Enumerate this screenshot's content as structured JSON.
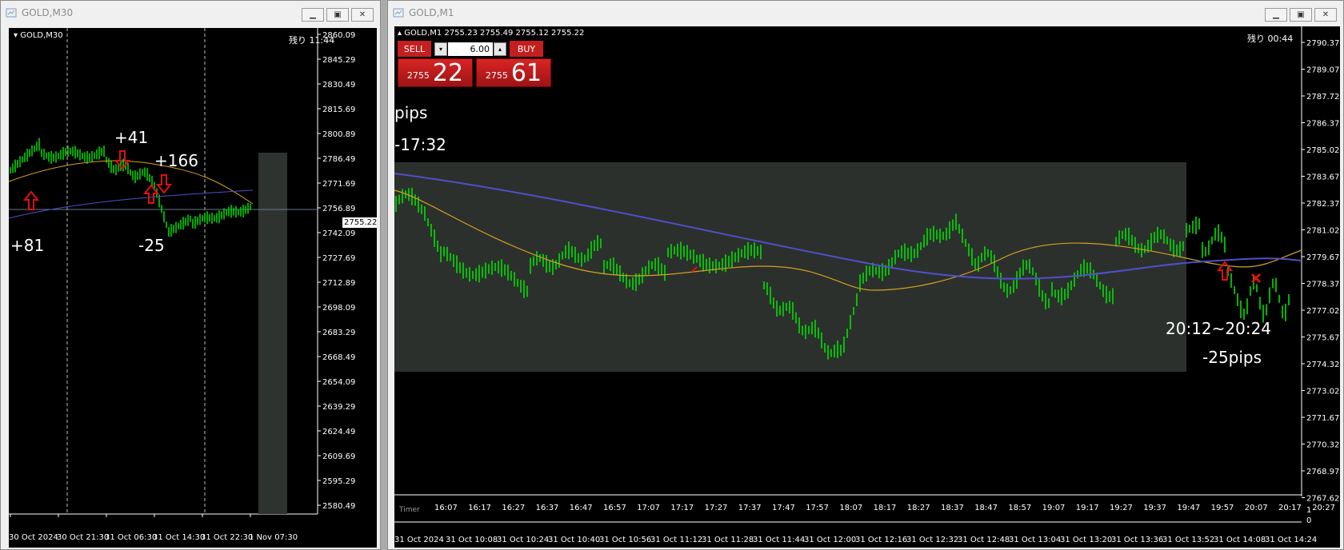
{
  "left_window": {
    "title": "GOLD,M30",
    "chart_label": "GOLD,M30",
    "countdown": "残り 11:44",
    "price_tag": "2755.22",
    "y_ticks": [
      "2860.09",
      "2845.29",
      "2830.49",
      "2815.69",
      "2800.89",
      "2786.49",
      "2771.69",
      "2756.89",
      "2742.09",
      "2727.69",
      "2712.89",
      "2698.09",
      "2683.29",
      "2668.49",
      "2654.09",
      "2639.29",
      "2624.49",
      "2609.69",
      "2595.29",
      "2580.49"
    ],
    "x_ticks": [
      "30 Oct 2024",
      "30 Oct 21:30",
      "31 Oct 06:30",
      "31 Oct 14:30",
      "31 Oct 22:30",
      "1 Nov 07:30"
    ],
    "annotations": {
      "a1": "+41",
      "a2": "+166",
      "a3": "+81",
      "a4": "-25"
    }
  },
  "right_window": {
    "title": "GOLD,M1",
    "chart_label": "GOLD,M1  2755.23 2755.49 2755.12 2755.22",
    "countdown": "残り 00:44",
    "one_click": {
      "sell_label": "SELL",
      "buy_label": "BUY",
      "lot": "6.00",
      "sell_small": "2755",
      "sell_big": "22",
      "buy_small": "2755",
      "buy_big": "61"
    },
    "annotations": {
      "pips": "pips",
      "time_left": "-17:32",
      "range": "20:12~20:24",
      "result": "-25pips"
    },
    "y_ticks": [
      "2790.37",
      "2789.07",
      "2787.72",
      "2786.37",
      "2785.02",
      "2783.67",
      "2782.37",
      "2781.02",
      "2779.67",
      "2778.37",
      "2777.02",
      "2775.67",
      "2774.32",
      "2773.02",
      "2771.67",
      "2770.32",
      "2768.97",
      "2767.62"
    ],
    "timer_label": "Timer",
    "timer_ticks": [
      "16:07",
      "16:17",
      "16:27",
      "16:37",
      "16:47",
      "16:57",
      "17:07",
      "17:17",
      "17:27",
      "17:37",
      "17:47",
      "17:57",
      "18:07",
      "18:17",
      "18:27",
      "18:37",
      "18:47",
      "18:57",
      "19:07",
      "19:17",
      "19:27",
      "19:37",
      "19:47",
      "19:57",
      "20:07",
      "20:17",
      "20:27"
    ],
    "timer_axis": [
      "1",
      "0"
    ],
    "x_ticks": [
      "31 Oct 2024",
      "31 Oct 10:08",
      "31 Oct 10:24",
      "31 Oct 10:40",
      "31 Oct 10:56",
      "31 Oct 11:12",
      "31 Oct 11:28",
      "31 Oct 11:44",
      "31 Oct 12:00",
      "31 Oct 12:16",
      "31 Oct 12:32",
      "31 Oct 12:48",
      "31 Oct 13:04",
      "31 Oct 13:20",
      "31 Oct 13:36",
      "31 Oct 13:52",
      "31 Oct 14:08",
      "31 Oct 14:24"
    ]
  },
  "colors": {
    "candle": "#00e000",
    "ma_fast": "#d4a020",
    "ma_slow": "#5050c8",
    "arrow": "#e01010",
    "background": "#000000"
  }
}
